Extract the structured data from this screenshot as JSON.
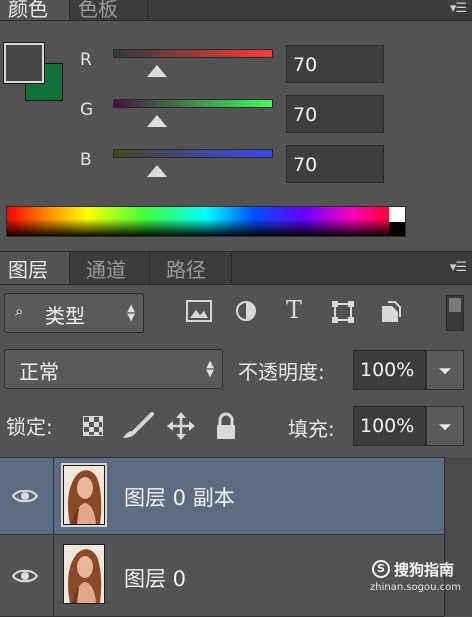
{
  "color_panel": {
    "tabs": [
      {
        "label": "颜色",
        "active": true
      },
      {
        "label": "色板",
        "active": false
      }
    ],
    "foreground_color": "#464646",
    "background_color": "#10703a",
    "channels": [
      {
        "label": "R",
        "value": "70",
        "track_from": "#2f3b3b",
        "track_to": "#ff3a3a"
      },
      {
        "label": "G",
        "value": "70",
        "track_from": "#46143f",
        "track_to": "#3cff5a"
      },
      {
        "label": "B",
        "value": "70",
        "track_from": "#46461e",
        "track_to": "#3e46ff"
      }
    ],
    "slider_level": 0.275
  },
  "layers_panel": {
    "tabs": [
      {
        "label": "图层",
        "active": true
      },
      {
        "label": "通道",
        "active": false
      },
      {
        "label": "路径",
        "active": false
      }
    ],
    "filter": {
      "label": "类型"
    },
    "filter_icons": [
      "image-filter-icon",
      "adjustment-filter-icon",
      "type-filter-icon",
      "shape-filter-icon",
      "smart-object-filter-icon"
    ],
    "blend_mode": "正常",
    "opacity_label": "不透明度:",
    "opacity_value": "100%",
    "lock_label": "锁定:",
    "lock_icons": [
      "lock-transparent-pixels-icon",
      "lock-image-pixels-icon",
      "lock-position-icon",
      "lock-all-icon"
    ],
    "fill_label": "填充:",
    "fill_value": "100%",
    "layers": [
      {
        "name": "图层 0 副本",
        "selected": true,
        "visible": true
      },
      {
        "name": "图层 0",
        "selected": false,
        "visible": true
      }
    ],
    "selected_row_color": "#5e6b82"
  },
  "watermark": {
    "line1": "搜狗指南",
    "line2": "zhinan.sogou.com"
  }
}
